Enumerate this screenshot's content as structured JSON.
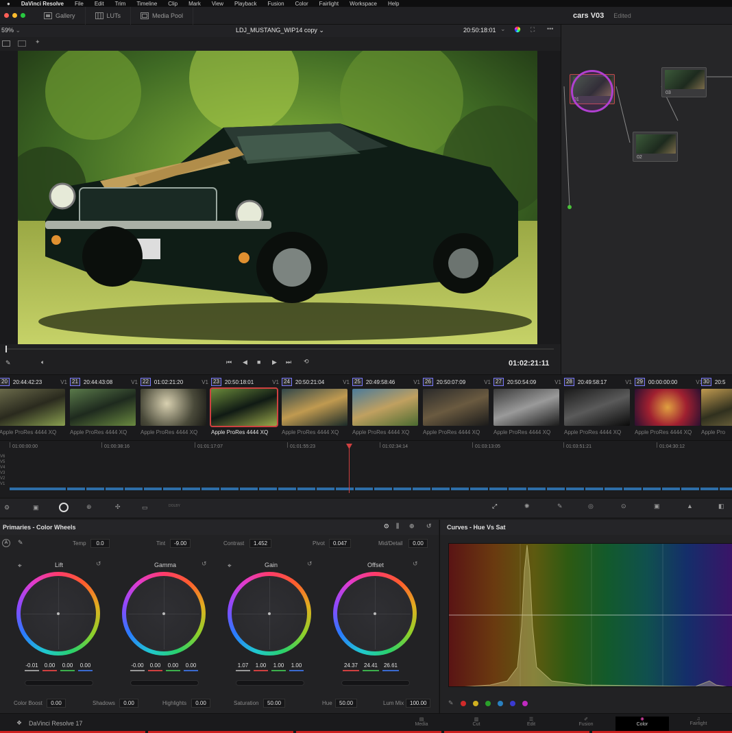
{
  "menubar": {
    "app": "DaVinci Resolve",
    "items": [
      "File",
      "Edit",
      "Trim",
      "Timeline",
      "Clip",
      "Mark",
      "View",
      "Playback",
      "Fusion",
      "Color",
      "Fairlight",
      "Workspace",
      "Help"
    ]
  },
  "topbar": {
    "gallery": "Gallery",
    "luts": "LUTs",
    "media_pool": "Media Pool",
    "project_title": "cars V03",
    "edited": "Edited"
  },
  "viewer": {
    "zoom": "59%",
    "clip_name": "LDJ_MUSTANG_WIP14 copy",
    "timecode": "20:50:18:01",
    "playhead_tc": "01:02:21:11"
  },
  "nodes": [
    {
      "label": "01"
    },
    {
      "label": "02"
    },
    {
      "label": "03"
    }
  ],
  "clips": [
    {
      "num": "20",
      "tc": "20:44:42:23",
      "track": "V1",
      "codec": "Apple ProRes 4444 XQ"
    },
    {
      "num": "21",
      "tc": "20:44:43:08",
      "track": "V1",
      "codec": "Apple ProRes 4444 XQ"
    },
    {
      "num": "22",
      "tc": "01:02:21:20",
      "track": "V1",
      "codec": "Apple ProRes 4444 XQ"
    },
    {
      "num": "23",
      "tc": "20:50:18:01",
      "track": "V1",
      "codec": "Apple ProRes 4444 XQ"
    },
    {
      "num": "24",
      "tc": "20:50:21:04",
      "track": "V1",
      "codec": "Apple ProRes 4444 XQ"
    },
    {
      "num": "25",
      "tc": "20:49:58:46",
      "track": "V1",
      "codec": "Apple ProRes 4444 XQ"
    },
    {
      "num": "26",
      "tc": "20:50:07:09",
      "track": "V1",
      "codec": "Apple ProRes 4444 XQ"
    },
    {
      "num": "27",
      "tc": "20:50:54:09",
      "track": "V1",
      "codec": "Apple ProRes 4444 XQ"
    },
    {
      "num": "28",
      "tc": "20:49:58:17",
      "track": "V1",
      "codec": "Apple ProRes 4444 XQ"
    },
    {
      "num": "29",
      "tc": "00:00:00:00",
      "track": "V1",
      "codec": "Apple ProRes 4444 XQ"
    },
    {
      "num": "30",
      "tc": "20:5",
      "track": "",
      "codec": "Apple Pro"
    }
  ],
  "timeline": {
    "ruler": [
      "01:00:00:00",
      "01:00:38:16",
      "01:01:17:07",
      "01:01:55:23",
      "01:02:34:14",
      "01:03:13:05",
      "01:03:51:21",
      "01:04:30:12"
    ],
    "tracks": [
      "V6",
      "V5",
      "V4",
      "V3",
      "V2",
      "V1"
    ]
  },
  "primaries": {
    "title": "Primaries - Color Wheels",
    "temp_label": "Temp",
    "temp": "0.0",
    "tint_label": "Tint",
    "tint": "-9.00",
    "contrast_label": "Contrast",
    "contrast": "1.452",
    "pivot_label": "Pivot",
    "pivot": "0.047",
    "middetail_label": "Mid/Detail",
    "middetail": "0.00",
    "wheels": [
      {
        "name": "Lift",
        "values": [
          "-0.01",
          "0.00",
          "0.00",
          "0.00"
        ]
      },
      {
        "name": "Gamma",
        "values": [
          "-0.00",
          "0.00",
          "0.00",
          "0.00"
        ]
      },
      {
        "name": "Gain",
        "values": [
          "1.07",
          "1.00",
          "1.00",
          "1.00"
        ]
      },
      {
        "name": "Offset",
        "values": [
          "24.37",
          "24.41",
          "26.61"
        ]
      }
    ],
    "color_boost_label": "Color Boost",
    "color_boost": "0.00",
    "shadows_label": "Shadows",
    "shadows": "0.00",
    "highlights_label": "Highlights",
    "highlights": "0.00",
    "saturation_label": "Saturation",
    "saturation": "50.00",
    "hue_label": "Hue",
    "hue": "50.00",
    "lummix_label": "Lum Mix",
    "lummix": "100.00"
  },
  "curves": {
    "title": "Curves - Hue Vs Sat"
  },
  "bottom": {
    "brand": "DaVinci Resolve 17",
    "pages": [
      "Media",
      "Cut",
      "Edit",
      "Fusion",
      "Color",
      "Fairlight"
    ]
  },
  "colors": {
    "accent": "#d04040",
    "selected_node": "#b040d0"
  }
}
